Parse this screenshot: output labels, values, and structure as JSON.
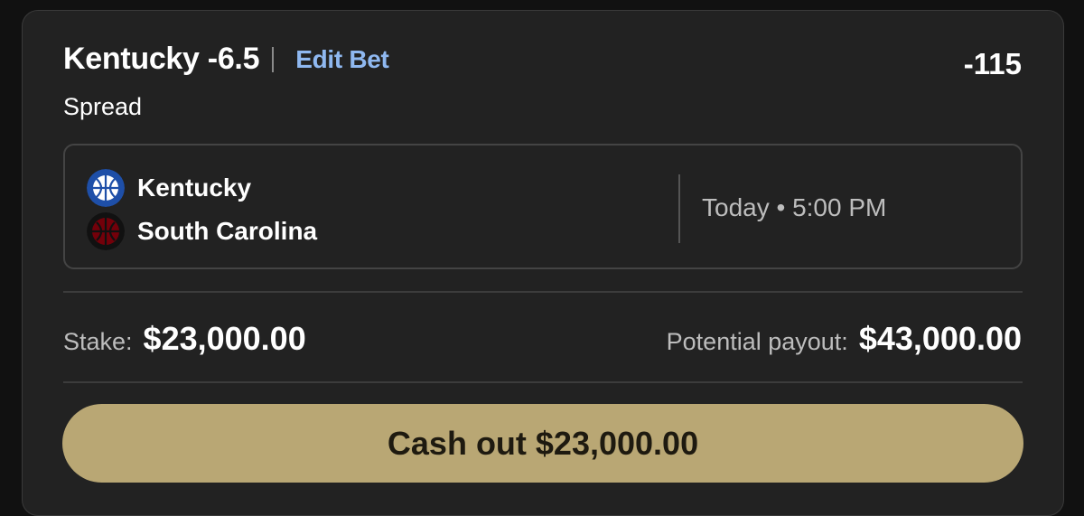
{
  "bet": {
    "title": "Kentucky -6.5",
    "edit_label": "Edit Bet",
    "odds": "-115",
    "type": "Spread"
  },
  "matchup": {
    "teams": [
      {
        "name": "Kentucky",
        "icon": "kentucky-basketball-logo-icon",
        "color": "#1e4fa8"
      },
      {
        "name": "South Carolina",
        "icon": "south-carolina-basketball-logo-icon",
        "color": "#73000a"
      }
    ],
    "time": "Today • 5:00 PM"
  },
  "amounts": {
    "stake_label": "Stake:",
    "stake_value": "$23,000.00",
    "payout_label": "Potential payout:",
    "payout_value": "$43,000.00"
  },
  "cashout": {
    "label": "Cash out $23,000.00",
    "color": "#b9a774"
  }
}
